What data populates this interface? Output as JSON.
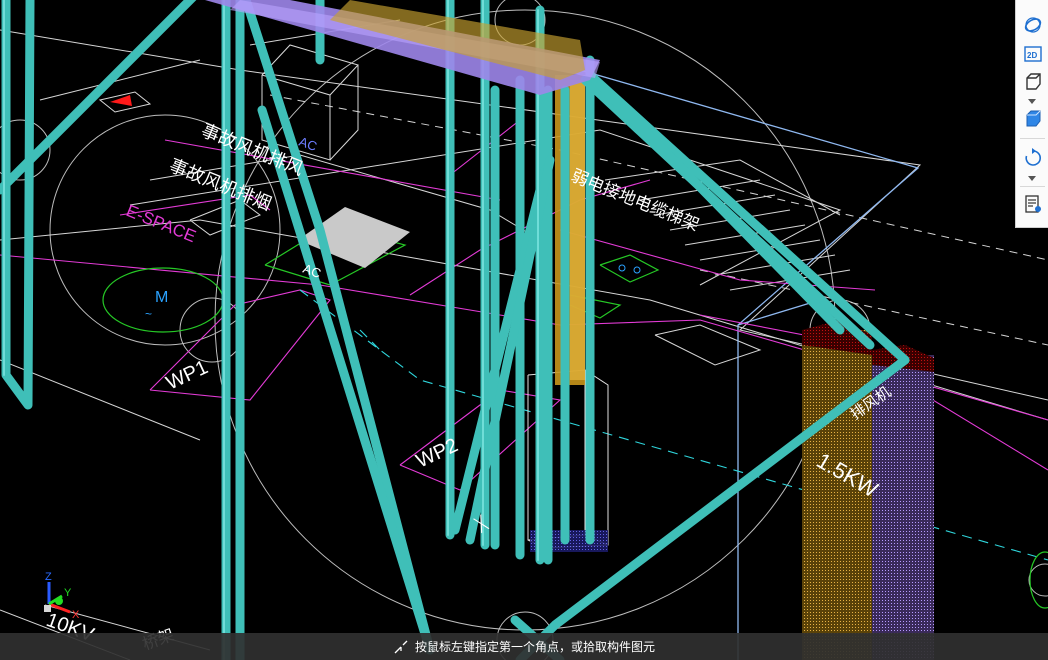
{
  "viewport": {
    "labels": {
      "ac_top": "AC",
      "ac_mid": "AC",
      "room_a": "事故风机排风",
      "room_b": "事故风机排烟",
      "espace": "E-SPACE",
      "motor": "M",
      "tilde": "~",
      "wp1": "WP1",
      "wp2": "WP2",
      "dist_label": "弱电接地电缆梯架",
      "fan_label": "排风机",
      "power": "1.5KW",
      "ten_kv": "10KV",
      "bridge": "桥架"
    }
  },
  "axes": {
    "z": "Z",
    "y": "Y",
    "x": "X"
  },
  "toolbar": {
    "items": [
      {
        "name": "orbit-icon",
        "label": "orbit"
      },
      {
        "name": "view-2d-icon",
        "label": "2D"
      },
      {
        "name": "cube-wireframe-icon",
        "label": "3D"
      },
      {
        "name": "cube-solid-icon",
        "label": "shaded"
      },
      {
        "name": "rotate-icon",
        "label": "rotate"
      },
      {
        "name": "properties-icon",
        "label": "properties"
      }
    ]
  },
  "status": {
    "message": "按鼠标左键指定第一个角点，或拾取构件图元"
  },
  "colors": {
    "pipe": "#3fbfb8",
    "duct_purple": "#a68cf2",
    "duct_orange": "#d7a31c",
    "magenta": "#e33bd6",
    "green": "#26c826",
    "cyan_dash": "#2fd6dc",
    "white_line": "#d8d8d8"
  }
}
